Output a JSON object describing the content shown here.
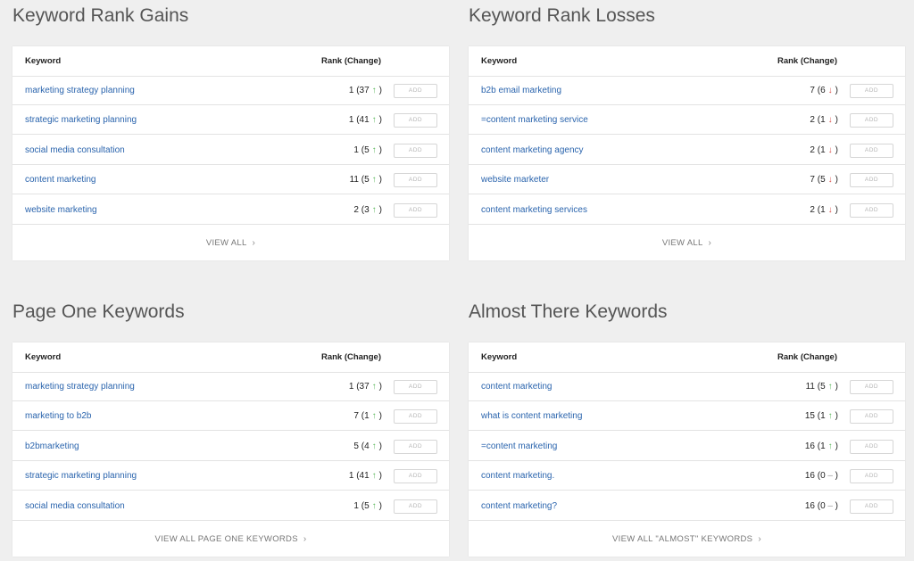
{
  "panels": [
    {
      "title": "Keyword Rank Gains",
      "col_keyword": "Keyword",
      "col_rank": "Rank (Change)",
      "rows": [
        {
          "keyword": "marketing strategy planning",
          "rank": "1",
          "change": "37",
          "dir": "up"
        },
        {
          "keyword": "strategic marketing planning",
          "rank": "1",
          "change": "41",
          "dir": "up"
        },
        {
          "keyword": "social media consultation",
          "rank": "1",
          "change": "5",
          "dir": "up"
        },
        {
          "keyword": "content marketing",
          "rank": "11",
          "change": "5",
          "dir": "up"
        },
        {
          "keyword": "website marketing",
          "rank": "2",
          "change": "3",
          "dir": "up"
        }
      ],
      "footer": "VIEW ALL"
    },
    {
      "title": "Keyword Rank Losses",
      "col_keyword": "Keyword",
      "col_rank": "Rank (Change)",
      "rows": [
        {
          "keyword": "b2b email marketing",
          "rank": "7",
          "change": "6",
          "dir": "down"
        },
        {
          "keyword": "=content marketing service",
          "rank": "2",
          "change": "1",
          "dir": "down"
        },
        {
          "keyword": "content marketing agency",
          "rank": "2",
          "change": "1",
          "dir": "down"
        },
        {
          "keyword": "website marketer",
          "rank": "7",
          "change": "5",
          "dir": "down"
        },
        {
          "keyword": "content marketing services",
          "rank": "2",
          "change": "1",
          "dir": "down"
        }
      ],
      "footer": "VIEW ALL"
    },
    {
      "title": "Page One Keywords",
      "col_keyword": "Keyword",
      "col_rank": "Rank (Change)",
      "rows": [
        {
          "keyword": "marketing strategy planning",
          "rank": "1",
          "change": "37",
          "dir": "up"
        },
        {
          "keyword": "marketing to b2b",
          "rank": "7",
          "change": "1",
          "dir": "up"
        },
        {
          "keyword": "b2bmarketing",
          "rank": "5",
          "change": "4",
          "dir": "up"
        },
        {
          "keyword": "strategic marketing planning",
          "rank": "1",
          "change": "41",
          "dir": "up"
        },
        {
          "keyword": "social media consultation",
          "rank": "1",
          "change": "5",
          "dir": "up"
        }
      ],
      "footer": "VIEW ALL PAGE ONE KEYWORDS"
    },
    {
      "title": "Almost There Keywords",
      "col_keyword": "Keyword",
      "col_rank": "Rank (Change)",
      "rows": [
        {
          "keyword": "content marketing",
          "rank": "11",
          "change": "5",
          "dir": "up"
        },
        {
          "keyword": "what is content marketing",
          "rank": "15",
          "change": "1",
          "dir": "up"
        },
        {
          "keyword": "=content marketing",
          "rank": "16",
          "change": "1",
          "dir": "up"
        },
        {
          "keyword": "content marketing.",
          "rank": "16",
          "change": "0",
          "dir": "flat"
        },
        {
          "keyword": "content marketing?",
          "rank": "16",
          "change": "0",
          "dir": "flat"
        }
      ],
      "footer": "VIEW ALL \"ALMOST\" KEYWORDS"
    }
  ],
  "add_label": "ADD",
  "icons": {
    "up": "arrow-up-icon",
    "down": "arrow-down-icon",
    "flat": "dash-icon",
    "footer": "chevron-right-icon"
  },
  "colors": {
    "link": "#2a64ad",
    "up": "#5cb85c",
    "down": "#d9534f",
    "flat": "#999999"
  }
}
